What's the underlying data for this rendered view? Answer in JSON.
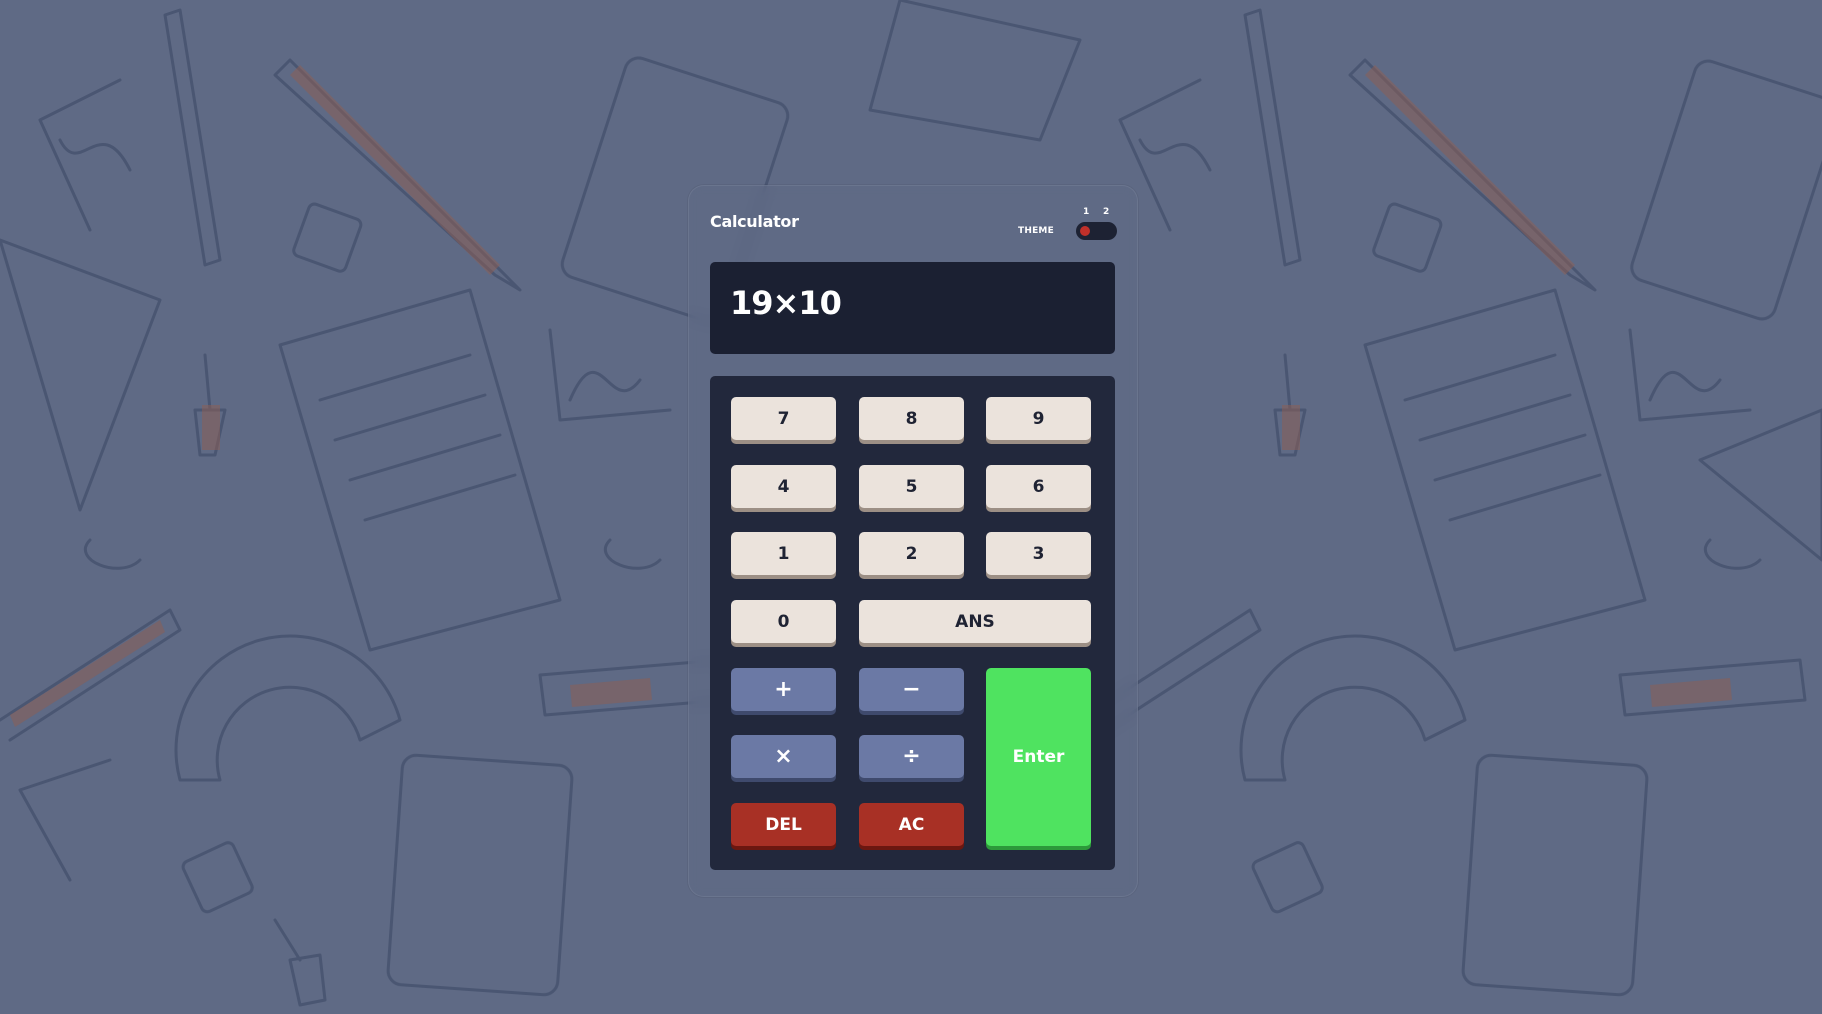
{
  "app": {
    "title": "Calculator"
  },
  "theme": {
    "label": "THEME",
    "options": [
      "1",
      "2"
    ],
    "selected": "1"
  },
  "display": {
    "value": "19×10"
  },
  "keys": {
    "seven": "7",
    "eight": "8",
    "nine": "9",
    "four": "4",
    "five": "5",
    "six": "6",
    "one": "1",
    "two": "2",
    "three": "3",
    "zero": "0",
    "ans": "ANS",
    "plus": "+",
    "minus": "−",
    "multiply": "×",
    "divide": "÷",
    "del": "DEL",
    "ac": "AC",
    "enter": "Enter"
  },
  "colors": {
    "background": "#5f6a85",
    "display": "#1b2032",
    "keypad": "#22283c",
    "number_key": "#ebe3dc",
    "operator_key": "#6b79a5",
    "delete_key": "#a83025",
    "enter_key": "#4fe360",
    "toggle_knob": "#c0302a"
  }
}
